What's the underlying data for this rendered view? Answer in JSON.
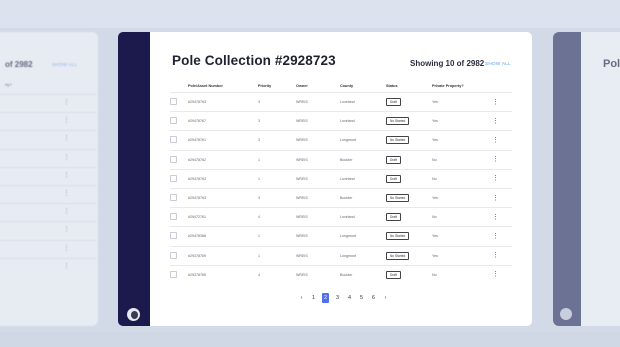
{
  "background_cards": {
    "left": {
      "title": "of 2982",
      "show_all": "SHOW ALL",
      "header_fragment": "rty?"
    },
    "right": {
      "title": "Pol"
    }
  },
  "main": {
    "title": "Pole Collection #2928723",
    "showing": "Showing  10 of 2982",
    "show_all": "SHOW ALL",
    "columns": [
      "",
      "Pole/Asset Number",
      "Priority",
      "Owner",
      "County",
      "Status",
      "Private Property?",
      ""
    ],
    "rows": [
      {
        "asset": "#29478763",
        "priority": "3",
        "owner": "WREIS",
        "county": "Loveland",
        "status": "Draft",
        "private": "Yes"
      },
      {
        "asset": "#29478767",
        "priority": "3",
        "owner": "WREIS",
        "county": "Loveland",
        "status": "No Started",
        "private": "Yes"
      },
      {
        "asset": "#29478761",
        "priority": "3",
        "owner": "WREIS",
        "county": "Longmont",
        "status": "No Started",
        "private": "Yes"
      },
      {
        "asset": "#29478762",
        "priority": "1",
        "owner": "WREIS",
        "county": "Boulder",
        "status": "Draft",
        "private": "No"
      },
      {
        "asset": "#29478763",
        "priority": "1",
        "owner": "WREIS",
        "county": "Loveland",
        "status": "Draft",
        "private": "No"
      },
      {
        "asset": "#29478763",
        "priority": "3",
        "owner": "WREIS",
        "county": "Boulder",
        "status": "No Started",
        "private": "Yes"
      },
      {
        "asset": "#29472761",
        "priority": "4",
        "owner": "WREIS",
        "county": "Loveland",
        "status": "Draft",
        "private": "No"
      },
      {
        "asset": "#29478368",
        "priority": "1",
        "owner": "WREIS",
        "county": "Longmont",
        "status": "No Started",
        "private": "Yes"
      },
      {
        "asset": "#29378769",
        "priority": "1",
        "owner": "WREIS",
        "county": "Longmont",
        "status": "No Started",
        "private": "Yes"
      },
      {
        "asset": "#29378765",
        "priority": "4",
        "owner": "WREIS",
        "county": "Boulder",
        "status": "Draft",
        "private": "No"
      }
    ],
    "row_menu_glyph": "⋮",
    "pagination": {
      "prev": "‹",
      "pages": [
        "1",
        "2",
        "3",
        "4",
        "5",
        "6"
      ],
      "current": "2",
      "next": "›"
    }
  },
  "icons": {
    "user_avatar": "avatar-icon",
    "row_menu": "kebab-icon",
    "checkbox": "checkbox-icon"
  },
  "colors": {
    "nav_dark": "#1c1a4c",
    "accent_blue": "#4f6ff0",
    "link_blue": "#5d97e2",
    "background": "#d3dae7"
  }
}
